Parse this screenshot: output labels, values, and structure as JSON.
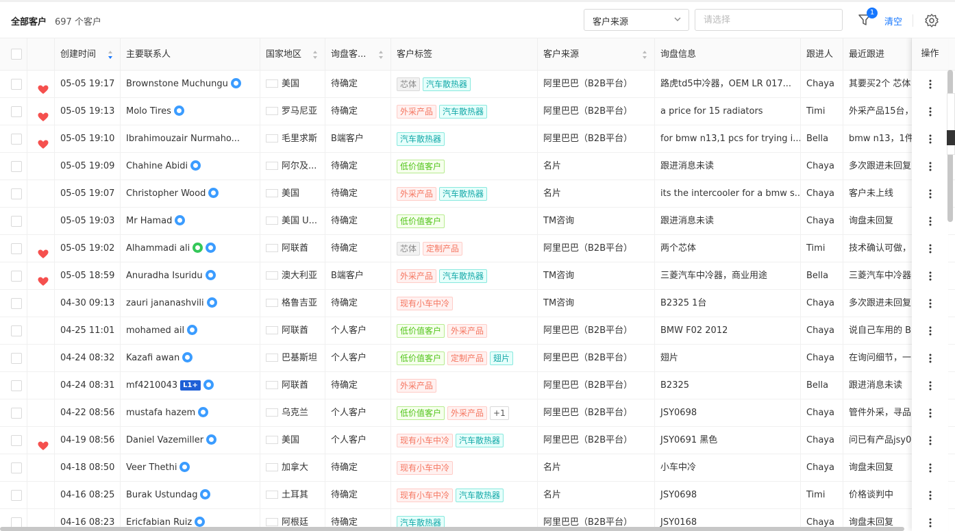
{
  "toolbar": {
    "title": "全部客户",
    "count": "697 个客户",
    "source_select": "客户来源",
    "source_placeholder": "请选择",
    "filter_badge": "1",
    "clear": "清空"
  },
  "columns": {
    "created": "创建时间",
    "contact": "主要联系人",
    "country": "国家地区",
    "type": "询盘客...",
    "tags": "客户标签",
    "source": "客户来源",
    "inquiry": "询盘信息",
    "follower": "跟进人",
    "recent": "最近跟进",
    "ops": "操作"
  },
  "rows": [
    {
      "fav": true,
      "time": "05-05 19:17",
      "name": "Brownstone Muchungu",
      "badges": [
        "verify"
      ],
      "flag": "us",
      "country": "美国",
      "type": "待确定",
      "tags": [
        [
          "芯体",
          "gray"
        ],
        [
          "汽车散热器",
          "teal"
        ]
      ],
      "source": "阿里巴巴（B2B平台）",
      "inquiry": "路虎td5中冷器，OEM LR 017...",
      "follower": "Chaya",
      "recent": "其要买2个 芯体"
    },
    {
      "fav": true,
      "time": "05-05 19:13",
      "name": "Molo Tires",
      "badges": [
        "verify"
      ],
      "flag": "ro",
      "country": "罗马尼亚",
      "type": "待确定",
      "tags": [
        [
          "外采产品",
          "red"
        ],
        [
          "汽车散热器",
          "teal"
        ]
      ],
      "source": "阿里巴巴（B2B平台）",
      "inquiry": "a price for 15 radiators",
      "follower": "Timi",
      "recent": "外采产品15台，"
    },
    {
      "fav": true,
      "time": "05-05 19:10",
      "name": "Ibrahimouzair Nurmaho...",
      "badges": [],
      "flag": "mu",
      "country": "毛里求斯",
      "type": "B端客户",
      "tags": [
        [
          "汽车散热器",
          "teal"
        ]
      ],
      "source": "阿里巴巴（B2B平台）",
      "inquiry": "for bmw n13,1 pcs for trying i...",
      "follower": "Bella",
      "recent": "bmw n13，1件"
    },
    {
      "fav": false,
      "time": "05-05 19:09",
      "name": "Chahine Abidi",
      "badges": [
        "verify"
      ],
      "flag": "dz",
      "country": "阿尔及...",
      "type": "待确定",
      "tags": [
        [
          "低价值客户",
          "green"
        ]
      ],
      "source": "名片",
      "inquiry": "跟进消息未读",
      "follower": "Chaya",
      "recent": "多次跟进未回复"
    },
    {
      "fav": false,
      "time": "05-05 19:07",
      "name": "Christopher Wood",
      "badges": [
        "verify"
      ],
      "flag": "us",
      "country": "美国",
      "type": "待确定",
      "tags": [
        [
          "外采产品",
          "red"
        ],
        [
          "汽车散热器",
          "teal"
        ]
      ],
      "source": "名片",
      "inquiry": "its the intercooler for a bmw s...",
      "follower": "Chaya",
      "recent": "客户未上线"
    },
    {
      "fav": false,
      "time": "05-05 19:03",
      "name": "Mr Hamad",
      "badges": [
        "verify"
      ],
      "flag": "us",
      "country": "美国 U...",
      "type": "待确定",
      "tags": [
        [
          "低价值客户",
          "green"
        ]
      ],
      "source": "TM咨询",
      "inquiry": "跟进消息未读",
      "follower": "Chaya",
      "recent": "询盘未回复"
    },
    {
      "fav": true,
      "time": "05-05 19:02",
      "name": "Alhammadi ali",
      "badges": [
        "chat",
        "verify"
      ],
      "flag": "ae",
      "country": "阿联酋",
      "type": "待确定",
      "tags": [
        [
          "芯体",
          "gray"
        ],
        [
          "定制产品",
          "red"
        ]
      ],
      "source": "阿里巴巴（B2B平台）",
      "inquiry": "两个芯体",
      "follower": "Timi",
      "recent": "技术确认可做，"
    },
    {
      "fav": true,
      "time": "05-05 18:59",
      "name": "Anuradha Isuridu",
      "badges": [
        "verify"
      ],
      "flag": "au",
      "country": "澳大利亚",
      "type": "B端客户",
      "tags": [
        [
          "外采产品",
          "red"
        ],
        [
          "汽车散热器",
          "teal"
        ]
      ],
      "source": "TM咨询",
      "inquiry": "三菱汽车中冷器，商业用途",
      "follower": "Bella",
      "recent": "三菱汽车中冷器"
    },
    {
      "fav": false,
      "time": "04-30 09:13",
      "name": "zauri jananashvili",
      "badges": [
        "verify"
      ],
      "flag": "ge",
      "country": "格鲁吉亚",
      "type": "待确定",
      "tags": [
        [
          "现有小车中冷",
          "red"
        ]
      ],
      "source": "TM咨询",
      "inquiry": "B2325 1台",
      "follower": "Chaya",
      "recent": "多次跟进未回复"
    },
    {
      "fav": false,
      "time": "04-25 11:01",
      "name": "mohamed ail",
      "badges": [
        "verify"
      ],
      "flag": "ae",
      "country": "阿联酋",
      "type": "个人客户",
      "tags": [
        [
          "低价值客户",
          "green"
        ],
        [
          "外采产品",
          "red"
        ]
      ],
      "source": "阿里巴巴（B2B平台）",
      "inquiry": "BMW F02 2012",
      "follower": "Chaya",
      "recent": "说自己车用的 B"
    },
    {
      "fav": false,
      "time": "04-24 08:32",
      "name": "Kazafi awan",
      "badges": [
        "verify"
      ],
      "flag": "pk",
      "country": "巴基斯坦",
      "type": "个人客户",
      "tags": [
        [
          "低价值客户",
          "green"
        ],
        [
          "定制产品",
          "red"
        ],
        [
          "翅片",
          "teal"
        ]
      ],
      "source": "阿里巴巴（B2B平台）",
      "inquiry": "翅片",
      "follower": "Chaya",
      "recent": "在询问细节，一"
    },
    {
      "fav": false,
      "time": "04-24 08:31",
      "name": "mf4210043",
      "badges": [
        "level",
        "verify"
      ],
      "level": "L1+",
      "flag": "ae",
      "country": "阿联酋",
      "type": "待确定",
      "tags": [
        [
          "外采产品",
          "red"
        ]
      ],
      "source": "阿里巴巴（B2B平台）",
      "inquiry": "B2325",
      "follower": "Bella",
      "recent": "跟进消息未读"
    },
    {
      "fav": false,
      "time": "04-22 08:56",
      "name": "mustafa hazem",
      "badges": [
        "verify"
      ],
      "flag": "ua",
      "country": "乌克兰",
      "type": "个人客户",
      "tags": [
        [
          "低价值客户",
          "green"
        ],
        [
          "外采产品",
          "red"
        ],
        [
          "+1",
          "plus"
        ]
      ],
      "source": "阿里巴巴（B2B平台）",
      "inquiry": "JSY0698",
      "follower": "Chaya",
      "recent": "管件外采，寻品"
    },
    {
      "fav": true,
      "time": "04-19 08:56",
      "name": "Daniel Vazemiller",
      "badges": [
        "verify"
      ],
      "flag": "us",
      "country": "美国",
      "type": "个人客户",
      "tags": [
        [
          "现有小车中冷",
          "red"
        ],
        [
          "汽车散热器",
          "teal"
        ]
      ],
      "source": "阿里巴巴（B2B平台）",
      "inquiry": "JSY0691 黑色",
      "follower": "Chaya",
      "recent": "问已有产品jsy0"
    },
    {
      "fav": false,
      "time": "04-18 08:50",
      "name": "Veer Thethi",
      "badges": [
        "verify"
      ],
      "flag": "ca",
      "country": "加拿大",
      "type": "待确定",
      "tags": [
        [
          "现有小车中冷",
          "red"
        ]
      ],
      "source": "名片",
      "inquiry": "小车中冷",
      "follower": "Chaya",
      "recent": "询盘未回复"
    },
    {
      "fav": false,
      "time": "04-16 08:25",
      "name": "Burak Ustundag",
      "badges": [
        "verify"
      ],
      "flag": "tr",
      "country": "土耳其",
      "type": "待确定",
      "tags": [
        [
          "现有小车中冷",
          "red"
        ],
        [
          "汽车散热器",
          "teal"
        ]
      ],
      "source": "名片",
      "inquiry": "JSY0698",
      "follower": "Timi",
      "recent": "价格谈判中"
    },
    {
      "fav": false,
      "time": "04-16 08:23",
      "name": "Ericfabian Ruiz",
      "badges": [
        "verify"
      ],
      "flag": "ar",
      "country": "阿根廷",
      "type": "待确定",
      "tags": [
        [
          "汽车散热器",
          "teal"
        ]
      ],
      "source": "阿里巴巴（B2B平台）",
      "inquiry": "JSY0168",
      "follower": "Chaya",
      "recent": "询盘未回复"
    }
  ]
}
